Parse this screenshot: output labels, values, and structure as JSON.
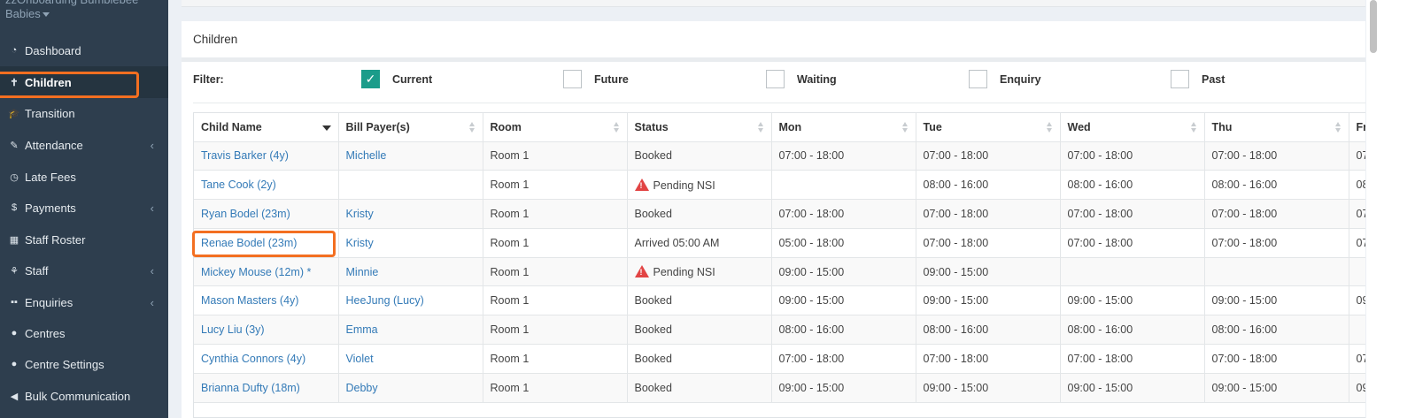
{
  "sidebar": {
    "org_name": "zzOnboarding Bumblebee Babies",
    "items": [
      {
        "label": "Dashboard",
        "icon": "dashboard-icon",
        "glyph": "◔"
      },
      {
        "label": "Children",
        "icon": "child-icon",
        "glyph": "✝"
      },
      {
        "label": "Transition",
        "icon": "graduation-cap-icon",
        "glyph": "🎓"
      },
      {
        "label": "Attendance",
        "icon": "edit-icon",
        "glyph": "✎",
        "arrow": "‹"
      },
      {
        "label": "Late Fees",
        "icon": "clock-icon",
        "glyph": "◷"
      },
      {
        "label": "Payments",
        "icon": "dollar-icon",
        "glyph": "$",
        "arrow": "‹"
      },
      {
        "label": "Staff Roster",
        "icon": "calendar-icon",
        "glyph": "▦"
      },
      {
        "label": "Staff",
        "icon": "sitemap-icon",
        "glyph": "⚘",
        "arrow": "‹"
      },
      {
        "label": "Enquiries",
        "icon": "grid-icon",
        "glyph": "▪▪",
        "arrow": "‹"
      },
      {
        "label": "Centres",
        "icon": "gear-icon",
        "glyph": "●"
      },
      {
        "label": "Centre Settings",
        "icon": "gear-icon",
        "glyph": "●"
      },
      {
        "label": "Bulk Communication",
        "icon": "bullhorn-icon",
        "glyph": "◀"
      }
    ]
  },
  "panel": {
    "title": "Children"
  },
  "filter": {
    "label": "Filter:",
    "options": [
      {
        "label": "Current",
        "checked": true
      },
      {
        "label": "Future",
        "checked": false
      },
      {
        "label": "Waiting",
        "checked": false
      },
      {
        "label": "Enquiry",
        "checked": false
      },
      {
        "label": "Past",
        "checked": false
      }
    ]
  },
  "table": {
    "columns": [
      "Child Name",
      "Bill Payer(s)",
      "Room",
      "Status",
      "Mon",
      "Tue",
      "Wed",
      "Thu",
      "Fr"
    ],
    "rows": [
      {
        "child": "Travis Barker (4y)",
        "payer": "Michelle",
        "room": "Room 1",
        "status": "Booked",
        "warn": false,
        "mon": "07:00 - 18:00",
        "tue": "07:00 - 18:00",
        "wed": "07:00 - 18:00",
        "thu": "07:00 - 18:00",
        "fri": "07"
      },
      {
        "child": "Tane Cook (2y)",
        "payer": "",
        "room": "Room 1",
        "status": "Pending NSI",
        "warn": true,
        "mon": "",
        "tue": "08:00 - 16:00",
        "wed": "08:00 - 16:00",
        "thu": "08:00 - 16:00",
        "fri": "08"
      },
      {
        "child": "Ryan Bodel (23m)",
        "payer": "Kristy",
        "room": "Room 1",
        "status": "Booked",
        "warn": false,
        "mon": "07:00 - 18:00",
        "tue": "07:00 - 18:00",
        "wed": "07:00 - 18:00",
        "thu": "07:00 - 18:00",
        "fri": "07"
      },
      {
        "child": "Renae Bodel (23m)",
        "payer": "Kristy",
        "room": "Room 1",
        "status": "Arrived 05:00 AM",
        "warn": false,
        "mon": "05:00 - 18:00",
        "tue": "07:00 - 18:00",
        "wed": "07:00 - 18:00",
        "thu": "07:00 - 18:00",
        "fri": "07"
      },
      {
        "child": "Mickey Mouse (12m) *",
        "payer": "Minnie",
        "room": "Room 1",
        "status": "Pending NSI",
        "warn": true,
        "mon": "09:00 - 15:00",
        "tue": "09:00 - 15:00",
        "wed": "",
        "thu": "",
        "fri": ""
      },
      {
        "child": "Mason Masters (4y)",
        "payer": "HeeJung (Lucy)",
        "room": "Room 1",
        "status": "Booked",
        "warn": false,
        "mon": "09:00 - 15:00",
        "tue": "09:00 - 15:00",
        "wed": "09:00 - 15:00",
        "thu": "09:00 - 15:00",
        "fri": "09"
      },
      {
        "child": "Lucy Liu (3y)",
        "payer": "Emma",
        "room": "Room 1",
        "status": "Booked",
        "warn": false,
        "mon": "08:00 - 16:00",
        "tue": "08:00 - 16:00",
        "wed": "08:00 - 16:00",
        "thu": "08:00 - 16:00",
        "fri": ""
      },
      {
        "child": "Cynthia Connors (4y)",
        "payer": "Violet",
        "room": "Room 1",
        "status": "Booked",
        "warn": false,
        "mon": "07:00 - 18:00",
        "tue": "07:00 - 18:00",
        "wed": "07:00 - 18:00",
        "thu": "07:00 - 18:00",
        "fri": "07"
      },
      {
        "child": "Brianna Dufty (18m)",
        "payer": "Debby",
        "room": "Room 1",
        "status": "Booked",
        "warn": false,
        "mon": "09:00 - 15:00",
        "tue": "09:00 - 15:00",
        "wed": "09:00 - 15:00",
        "thu": "09:00 - 15:00",
        "fri": "09"
      }
    ]
  },
  "colors": {
    "sidebar_bg": "#2e3e4e",
    "link": "#337ab7",
    "highlight": "#f36f21",
    "checkbox": "#1b9c8a",
    "warning": "#e24444"
  }
}
